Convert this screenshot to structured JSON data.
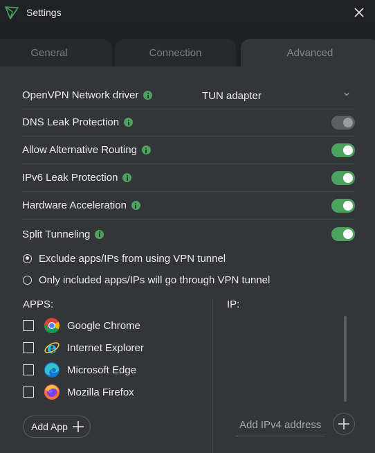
{
  "window": {
    "title": "Settings"
  },
  "tabs": [
    {
      "label": "General"
    },
    {
      "label": "Connection"
    },
    {
      "label": "Advanced"
    }
  ],
  "settings": {
    "network_driver": {
      "label": "OpenVPN Network driver",
      "value": "TUN adapter"
    },
    "dns_leak": {
      "label": "DNS Leak Protection",
      "enabled": false
    },
    "alt_routing": {
      "label": "Allow Alternative Routing",
      "enabled": true
    },
    "ipv6_leak": {
      "label": "IPv6 Leak Protection",
      "enabled": true
    },
    "hw_accel": {
      "label": "Hardware Acceleration",
      "enabled": true
    },
    "split_tunnel": {
      "label": "Split Tunneling",
      "enabled": true
    }
  },
  "split_mode": {
    "options": [
      {
        "label": "Exclude apps/IPs from using VPN tunnel",
        "selected": true
      },
      {
        "label": "Only included apps/IPs will go through VPN tunnel",
        "selected": false
      }
    ]
  },
  "apps": {
    "heading": "APPS:",
    "items": [
      {
        "name": "Google Chrome",
        "icon": "chrome-icon",
        "checked": false
      },
      {
        "name": "Internet Explorer",
        "icon": "internet-explorer-icon",
        "checked": false
      },
      {
        "name": "Microsoft Edge",
        "icon": "edge-icon",
        "checked": false
      },
      {
        "name": "Mozilla Firefox",
        "icon": "firefox-icon",
        "checked": false
      }
    ],
    "add_label": "Add App"
  },
  "ip": {
    "heading": "IP:",
    "placeholder": "Add IPv4 address"
  },
  "colors": {
    "accent": "#4ca35d",
    "background": "#333538",
    "titlebar": "#1f2124"
  }
}
